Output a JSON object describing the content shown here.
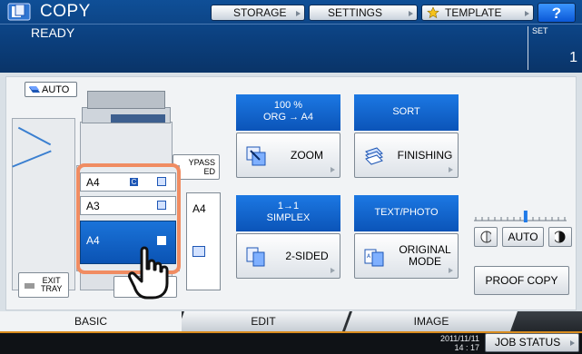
{
  "header": {
    "title": "COPY",
    "status": "READY",
    "set_label": "SET",
    "set_value": "1",
    "buttons": {
      "storage": "STORAGE",
      "settings": "SETTINGS",
      "template": "TEMPLATE",
      "help": "?"
    }
  },
  "main": {
    "auto_label": "AUTO",
    "bypass_label_1": "YPASS",
    "bypass_label_2": "ED",
    "side_tray_size": "A4",
    "trays": [
      {
        "size": "A4",
        "badge": "C",
        "selected": false
      },
      {
        "size": "A3",
        "selected": false
      },
      {
        "size": "A4",
        "selected": true
      }
    ],
    "exit_tray_1": "EXIT",
    "exit_tray_2": "TRAY"
  },
  "functions": {
    "zoom": {
      "head_1": "100 %",
      "head_2": "ORG  →  A4",
      "button": "ZOOM"
    },
    "finishing": {
      "head": "SORT",
      "button": "FINISHING"
    },
    "sided": {
      "head_1": "1→1",
      "head_2": "SIMPLEX",
      "button": "2-SIDED"
    },
    "original": {
      "head": "TEXT/PHOTO",
      "button_1": "ORIGINAL",
      "button_2": "MODE"
    }
  },
  "density": {
    "auto_label": "AUTO",
    "proof_copy": "PROOF COPY",
    "level_fraction": 0.56
  },
  "tabs": {
    "basic": "BASIC",
    "edit": "EDIT",
    "image": "IMAGE"
  },
  "footer": {
    "date": "2011/11/11",
    "time": "14 : 17",
    "job_status": "JOB STATUS"
  },
  "colors": {
    "accent_blue": "#0b54b8",
    "header_blue": "#0f4f97",
    "highlight": "#f08c62"
  }
}
